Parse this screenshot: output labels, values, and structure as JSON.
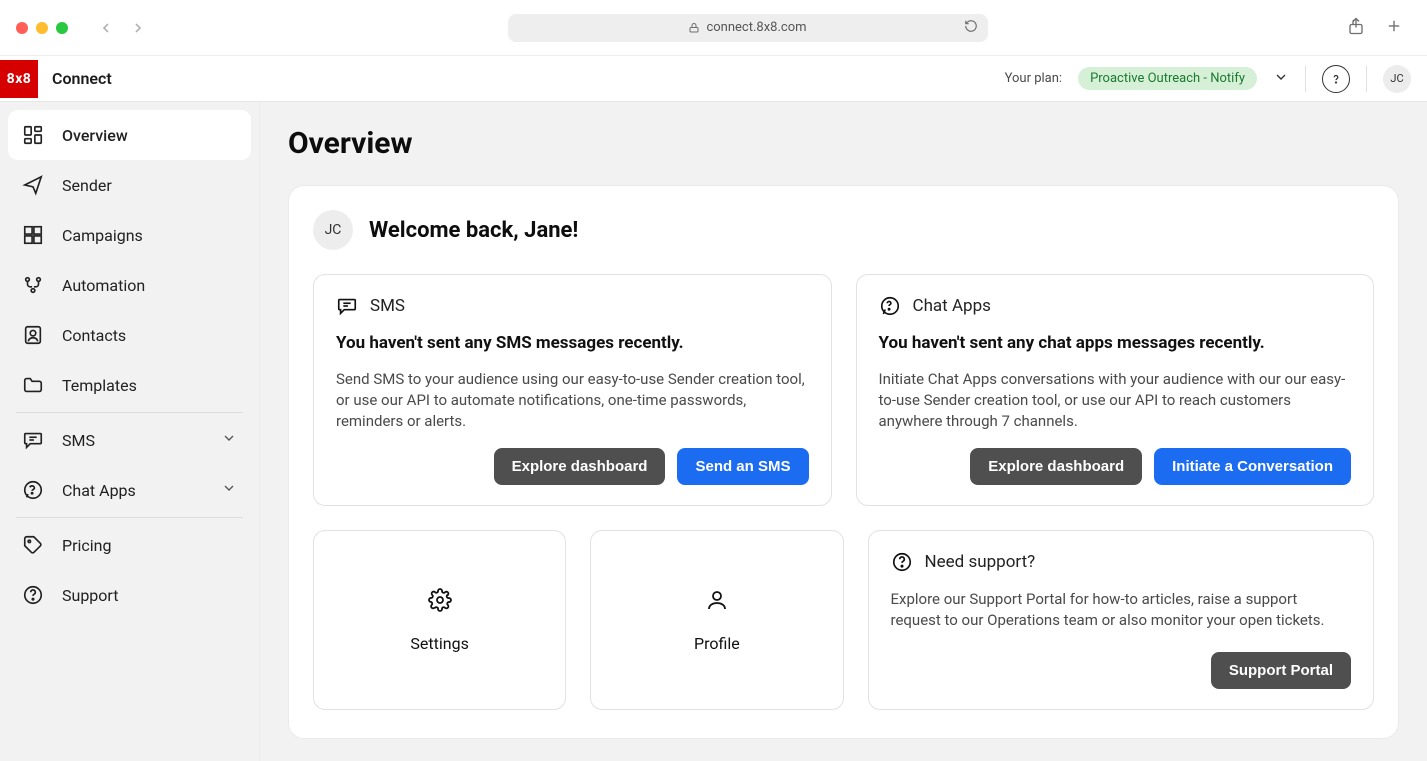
{
  "browser": {
    "url": "connect.8x8.com"
  },
  "header": {
    "logo_text": "8x8",
    "brand": "Connect",
    "plan_label": "Your plan:",
    "plan_value": "Proactive Outreach - Notify",
    "avatar_initials": "JC"
  },
  "sidebar": {
    "items": [
      {
        "label": "Overview",
        "icon": "dashboard-icon",
        "active": true
      },
      {
        "label": "Sender",
        "icon": "send-icon"
      },
      {
        "label": "Campaigns",
        "icon": "grid-icon"
      },
      {
        "label": "Automation",
        "icon": "flow-icon"
      },
      {
        "label": "Contacts",
        "icon": "contacts-icon"
      },
      {
        "label": "Templates",
        "icon": "folder-icon"
      },
      {
        "divider": true
      },
      {
        "label": "SMS",
        "icon": "chat-icon",
        "expandable": true
      },
      {
        "label": "Chat Apps",
        "icon": "whatsapp-icon",
        "expandable": true
      },
      {
        "divider": true
      },
      {
        "label": "Pricing",
        "icon": "tag-icon"
      },
      {
        "label": "Support",
        "icon": "help-icon"
      }
    ]
  },
  "main": {
    "title": "Overview",
    "welcome_initials": "JC",
    "welcome_text": "Welcome back, Jane!",
    "panels": {
      "sms": {
        "title": "SMS",
        "headline": "You haven't sent any SMS messages recently.",
        "desc": "Send SMS to your audience using our easy-to-use Sender creation tool, or use our API to automate notifications, one-time passwords, reminders or alerts.",
        "secondary_btn": "Explore dashboard",
        "primary_btn": "Send an SMS"
      },
      "chat": {
        "title": "Chat Apps",
        "headline": "You haven't sent any chat apps messages recently.",
        "desc": "Initiate Chat Apps conversations with your audience with our our easy-to-use Sender creation tool, or use our API to reach customers anywhere through 7 channels.",
        "secondary_btn": "Explore dashboard",
        "primary_btn": "Initiate a Conversation"
      },
      "support": {
        "title": "Need support?",
        "desc": "Explore our Support Portal for how-to articles, raise a support request to our Operations team or also monitor your open tickets.",
        "btn": "Support Portal"
      }
    },
    "tiles": {
      "settings": "Settings",
      "profile": "Profile"
    }
  }
}
